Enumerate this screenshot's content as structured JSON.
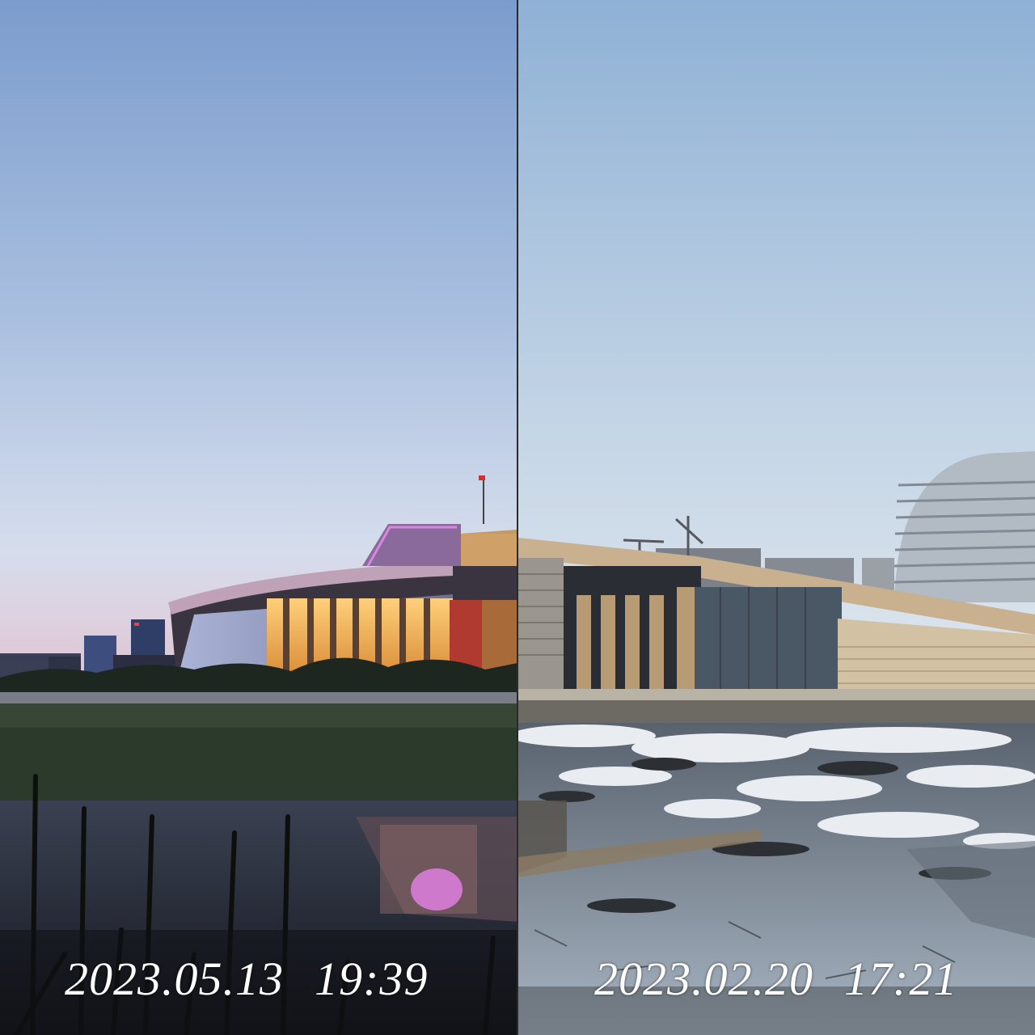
{
  "left_photo": {
    "date": "2023.05.13",
    "time": "19:39"
  },
  "right_photo": {
    "date": "2023.02.20",
    "time": "17:21"
  },
  "colors": {
    "evening_sky_top": "#7f9fcf",
    "evening_sky_horizon": "#e5d8e6",
    "winter_sky_top": "#8fb2d6",
    "winter_sky_horizon": "#dfe7ee",
    "building_glow": "#f2a64a",
    "magenta_light": "#d07ad8",
    "facade_beige": "#c8b79b"
  }
}
